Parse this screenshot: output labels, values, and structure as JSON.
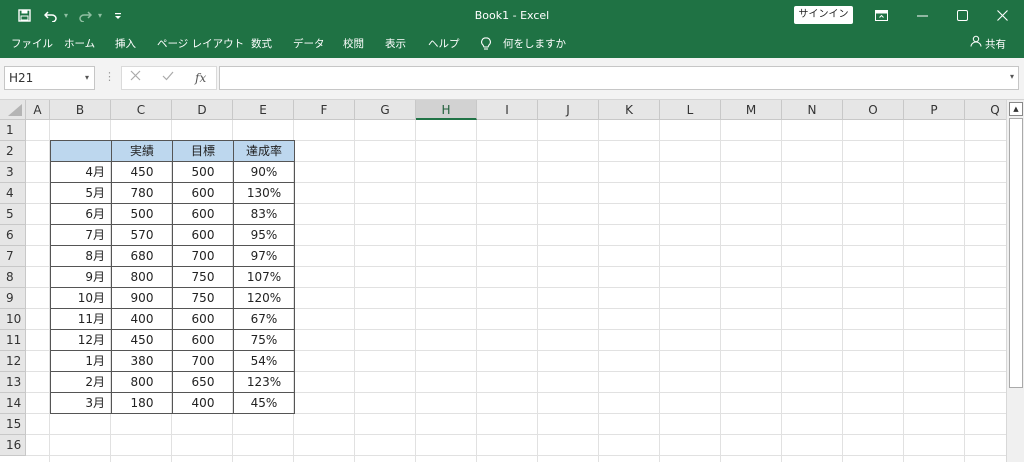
{
  "titlebar": {
    "title": "Book1  -  Excel",
    "save_icon": "save-icon",
    "undo_icon": "undo-icon",
    "redo_icon": "redo-icon",
    "customize_icon": "customize-quick-access-icon",
    "signin_label": "サインイン",
    "ribbon_display_icon": "ribbon-display-options-icon",
    "minimize_icon": "minimize-icon",
    "maximize_icon": "maximize-icon",
    "close_icon": "close-icon"
  },
  "ribbon": {
    "tabs": [
      "ファイル",
      "ホーム",
      "挿入",
      "ページ レイアウト",
      "数式",
      "データ",
      "校閲",
      "表示",
      "ヘルプ"
    ],
    "tell_me_icon": "lightbulb-icon",
    "tell_me_label": "何をしますか",
    "share_icon": "person-icon",
    "share_label": "共有"
  },
  "formula_bar": {
    "name_box_value": "H21",
    "cancel_icon": "cancel-icon",
    "enter_icon": "check-icon",
    "function_icon": "fx",
    "formula_value": ""
  },
  "sheet": {
    "columns": [
      "A",
      "B",
      "C",
      "D",
      "E",
      "F",
      "G",
      "H",
      "I",
      "J",
      "K",
      "L",
      "M",
      "N",
      "O",
      "P",
      "Q"
    ],
    "rows": [
      "1",
      "2",
      "3",
      "4",
      "5",
      "6",
      "7",
      "8",
      "9",
      "10",
      "11",
      "12",
      "13",
      "14",
      "15",
      "16"
    ],
    "selected_column": "H",
    "table": {
      "header": [
        "",
        "実績",
        "目標",
        "達成率"
      ],
      "rows": [
        [
          "4月",
          "450",
          "500",
          "90%"
        ],
        [
          "5月",
          "780",
          "600",
          "130%"
        ],
        [
          "6月",
          "500",
          "600",
          "83%"
        ],
        [
          "7月",
          "570",
          "600",
          "95%"
        ],
        [
          "8月",
          "680",
          "700",
          "97%"
        ],
        [
          "9月",
          "800",
          "750",
          "107%"
        ],
        [
          "10月",
          "900",
          "750",
          "120%"
        ],
        [
          "11月",
          "400",
          "600",
          "67%"
        ],
        [
          "12月",
          "450",
          "600",
          "75%"
        ],
        [
          "1月",
          "380",
          "700",
          "54%"
        ],
        [
          "2月",
          "800",
          "650",
          "123%"
        ],
        [
          "3月",
          "180",
          "400",
          "45%"
        ]
      ]
    },
    "header_fill_color": "#bdd7ee"
  },
  "colors": {
    "excel_green": "#1f7244"
  }
}
